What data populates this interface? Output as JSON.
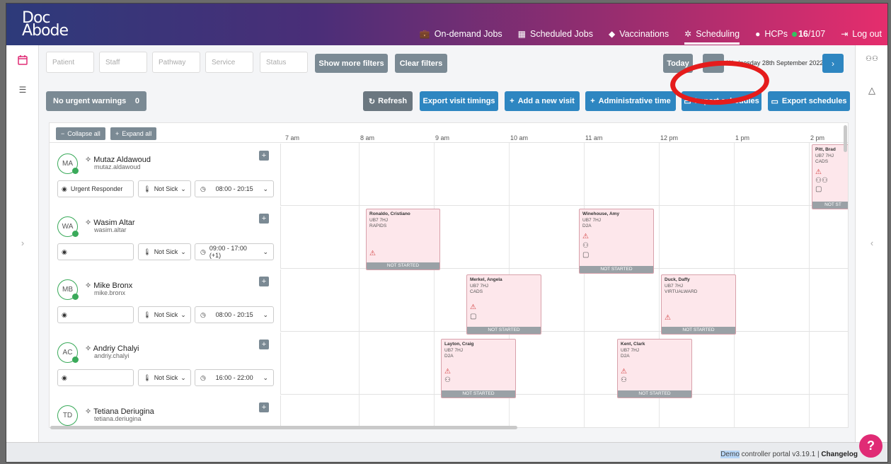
{
  "logo": {
    "line1": "Doc",
    "line2": "Abode"
  },
  "nav": [
    {
      "icon": "briefcase-icon",
      "glyph": "💼",
      "label": "On-demand Jobs"
    },
    {
      "icon": "calendar-grid-icon",
      "glyph": "▦",
      "label": "Scheduled Jobs"
    },
    {
      "icon": "shield-icon",
      "glyph": "◆",
      "label": "Vaccinations"
    },
    {
      "icon": "sun-icon",
      "glyph": "✲",
      "label": "Scheduling"
    },
    {
      "icon": "info-icon",
      "glyph": "●",
      "hcp_label": "HCPs",
      "hcp_count": "16",
      "hcp_total": "/107"
    },
    {
      "icon": "logout-icon",
      "glyph": "⇥",
      "label": "Log out"
    }
  ],
  "filters": {
    "patient": "Patient",
    "staff": "Staff",
    "pathway": "Pathway",
    "service": "Service",
    "status": "Status",
    "more": "Show more filters",
    "clear": "Clear filters"
  },
  "datebar": {
    "today": "Today",
    "prev": "‹",
    "date": "Wednesday 28th September 2022",
    "next": "›"
  },
  "warnings": {
    "label": "No urgent warnings",
    "count": "0"
  },
  "actions": {
    "refresh": "Refresh",
    "export_timings": "Export visit timings",
    "add_visit": "Add a new visit",
    "admin_time": "Administrative time",
    "import": "Import schedules",
    "export": "Export schedules"
  },
  "grid": {
    "collapse": "Collapse all",
    "expand": "Expand all",
    "times": [
      "7 am",
      "8 am",
      "9 am",
      "10 am",
      "11 am",
      "12 pm",
      "1 pm",
      "2 pm"
    ]
  },
  "staff": [
    {
      "initials": "MA",
      "name": "Mutaz Aldawoud",
      "username": "mutaz.aldawoud",
      "role": "Urgent Responder",
      "sick": "Not Sick",
      "shift": "08:00 - 20:15"
    },
    {
      "initials": "WA",
      "name": "Wasim Altar",
      "username": "wasim.altar",
      "role": "",
      "sick": "Not Sick",
      "shift": "09:00 - 17:00 (+1)"
    },
    {
      "initials": "MB",
      "name": "Mike Bronx",
      "username": "mike.bronx",
      "role": "",
      "sick": "Not Sick",
      "shift": "08:00 - 20:15"
    },
    {
      "initials": "AC",
      "name": "Andriy Chalyi",
      "username": "andriy.chalyi",
      "role": "",
      "sick": "Not Sick",
      "shift": "16:00 - 22:00"
    },
    {
      "initials": "TD",
      "name": "Tetiana Deriugina",
      "username": "tetiana.deriugina"
    }
  ],
  "visits": [
    {
      "name": "Pitt, Brad",
      "postcode": "UB7 7HJ",
      "service": "CADS",
      "status": "NOT ST"
    },
    {
      "name": "Ronaldo, Cristiano",
      "postcode": "UB7 7HJ",
      "service": "RAPIDS",
      "status": "NOT STARTED"
    },
    {
      "name": "Winehouse, Amy",
      "postcode": "UB7 7HJ",
      "service": "D2A",
      "status": "NOT STARTED"
    },
    {
      "name": "Merkel, Angela",
      "postcode": "UB7 7HJ",
      "service": "CADS",
      "status": "NOT STARTED"
    },
    {
      "name": "Duck, Daffy",
      "postcode": "UB7 7HJ",
      "service": "VIRTUALWARD",
      "status": "NOT STARTED"
    },
    {
      "name": "Layton, Craig",
      "postcode": "UB7 7HJ",
      "service": "D2A",
      "status": "NOT STARTED"
    },
    {
      "name": "Kent, Clark",
      "postcode": "UB7 7HJ",
      "service": "D2A",
      "status": "NOT STARTED"
    }
  ],
  "footer": {
    "demo": "Demo",
    "portal": " controller portal v3.19.1 | ",
    "changelog": "Changelog"
  },
  "help": "?",
  "colors": {
    "accent": "#2e86c1",
    "gray_button": "#7b8a94",
    "visit_bg": "#fde7eb",
    "annotation": "#e51c1c"
  }
}
